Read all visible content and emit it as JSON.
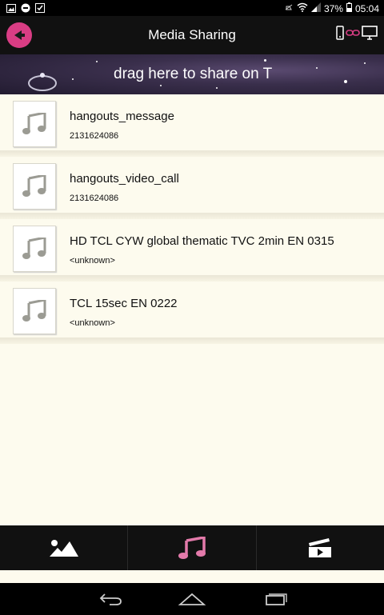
{
  "status_bar": {
    "battery": "37%",
    "time": "05:04"
  },
  "app": {
    "title": "Media Sharing",
    "accent": "#d93d84"
  },
  "banner": {
    "text": "drag here to share on T"
  },
  "items": [
    {
      "title": "hangouts_message",
      "subtitle": "2131624086"
    },
    {
      "title": "hangouts_video_call",
      "subtitle": "2131624086"
    },
    {
      "title": "HD TCL CYW global thematic TVC 2min EN 0315",
      "subtitle": "<unknown>"
    },
    {
      "title": "TCL 15sec EN 0222",
      "subtitle": "<unknown>"
    }
  ],
  "tabs": [
    {
      "icon": "image-icon",
      "selected": false
    },
    {
      "icon": "music-icon",
      "selected": true
    },
    {
      "icon": "video-icon",
      "selected": false
    }
  ]
}
